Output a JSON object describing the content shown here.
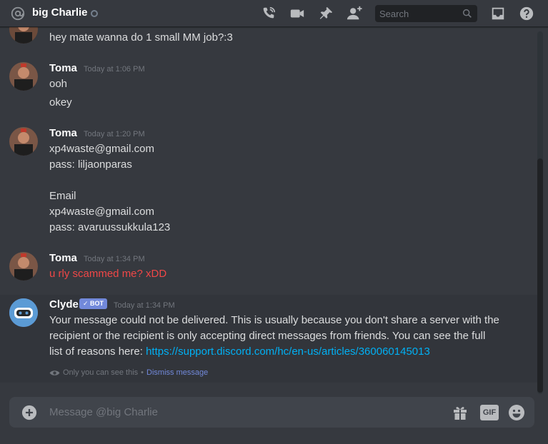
{
  "header": {
    "name": "big Charlie",
    "search_placeholder": "Search",
    "icons": [
      "at-icon",
      "status-offline-icon",
      "phone-call-icon",
      "video-call-icon",
      "pin-icon",
      "add-friend-icon",
      "search-icon",
      "inbox-icon",
      "help-icon"
    ]
  },
  "messages": [
    {
      "author": "",
      "lines": [
        "hey mate wanna do 1 small MM job?:3"
      ]
    },
    {
      "author": "Toma",
      "timestamp": "Today at 1:06 PM",
      "lines": [
        "ooh",
        "okey"
      ]
    },
    {
      "author": "Toma",
      "timestamp": "Today at 1:20 PM",
      "lines": [
        "xp4waste@gmail.com",
        "pass: liljaonparas",
        "Email",
        "xp4waste@gmail.com",
        "pass: avaruussukkula123"
      ]
    },
    {
      "author": "Toma",
      "timestamp": "Today at 1:34 PM",
      "lines": [
        "u rly scammed me? xDD"
      ]
    }
  ],
  "clyde": {
    "author": "Clyde",
    "badge": "BOT",
    "timestamp": "Today at 1:34 PM",
    "line1": "Your message could not be delivered. This is usually because you don't share a server with the",
    "line2": "recipient or the recipient is only accepting direct messages from friends. You can see the full",
    "line3_prefix": "list of reasons here: ",
    "link": "https://support.discord.com/hc/en-us/articles/360060145013",
    "ephemeral_note": "Only you can see this",
    "separator": "•",
    "dismiss": "Dismiss message"
  },
  "composer": {
    "placeholder": "Message @big Charlie",
    "gif_label": "GIF"
  },
  "colors": {
    "background": "#36393f",
    "accent": "#7289da",
    "link": "#00b0f4",
    "error_text": "#f04747"
  }
}
